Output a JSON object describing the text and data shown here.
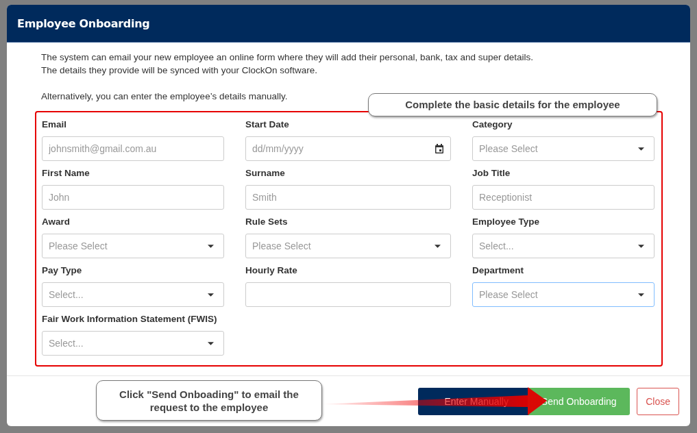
{
  "window": {
    "title": "Employee Onboarding"
  },
  "intro": [
    "The system can email your new employee an online form where they will add their personal, bank, tax and super details.",
    "The details they provide will be synced with your ClockOn software.",
    "Alternatively, you can enter the employee’s details manually."
  ],
  "fields": [
    {
      "label": "Email",
      "kind": "text",
      "placeholder": "johnsmith@gmail.com.au",
      "focused": false
    },
    {
      "label": "Start Date",
      "kind": "date",
      "placeholder": "dd/mm/yyyy",
      "focused": false
    },
    {
      "label": "Category",
      "kind": "select",
      "placeholder": "Please Select",
      "focused": false
    },
    {
      "label": "First Name",
      "kind": "text",
      "placeholder": "John",
      "focused": false
    },
    {
      "label": "Surname",
      "kind": "text",
      "placeholder": "Smith",
      "focused": false
    },
    {
      "label": "Job Title",
      "kind": "text",
      "placeholder": "Receptionist",
      "focused": false
    },
    {
      "label": "Award",
      "kind": "select",
      "placeholder": "Please Select",
      "focused": false
    },
    {
      "label": "Rule Sets",
      "kind": "select",
      "placeholder": "Please Select",
      "focused": false
    },
    {
      "label": "Employee Type",
      "kind": "select",
      "placeholder": "Select...",
      "focused": false
    },
    {
      "label": "Pay Type",
      "kind": "select",
      "placeholder": "Select...",
      "focused": false
    },
    {
      "label": "Hourly Rate",
      "kind": "text",
      "focused": false
    },
    {
      "label": "Department",
      "kind": "select",
      "placeholder": "Please Select",
      "focused": true
    },
    {
      "label": "Fair Work Information Statement (FWIS)",
      "kind": "select",
      "placeholder": "Select...",
      "focused": false
    }
  ],
  "buttons": [
    {
      "label": "Enter Manually",
      "kind": "primary"
    },
    {
      "label": "Send Onboarding",
      "kind": "success"
    },
    {
      "label": "Close",
      "kind": "outline"
    }
  ],
  "annotations": [
    {
      "kind": "top",
      "text": "Complete the basic details for the employee"
    },
    {
      "kind": "bottom",
      "text": "Click \"Send Onboading\" to email the request to the employee"
    }
  ]
}
